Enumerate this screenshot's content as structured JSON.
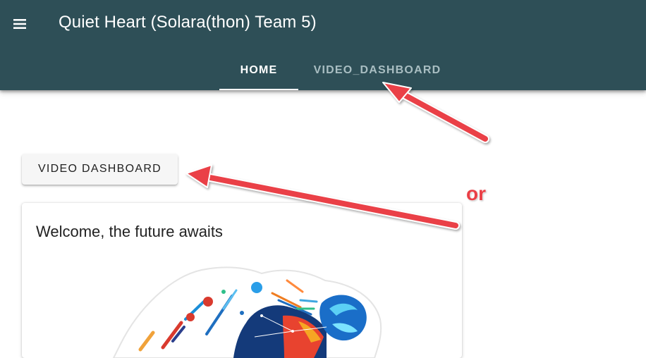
{
  "app": {
    "title": "Quiet Heart (Solara(thon) Team 5)",
    "menu_icon": "hamburger-menu-icon"
  },
  "tabs": [
    {
      "label": "Home",
      "active": true
    },
    {
      "label": "video_dashboard",
      "active": false
    }
  ],
  "main": {
    "video_button_label": "Video Dashboard",
    "card_title": "Welcome, the future awaits"
  },
  "annotation": {
    "or_text": "or",
    "arrow_color": "#ea3f46"
  },
  "colors": {
    "appbar": "#2e4f57",
    "tab_active": "#ffffff",
    "tab_inactive": "#a9bec2"
  }
}
